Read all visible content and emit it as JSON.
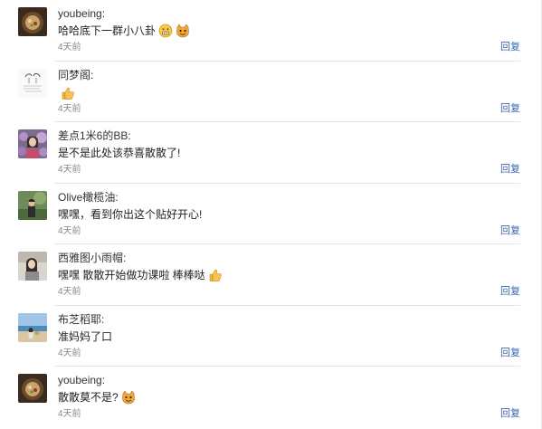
{
  "comments": [
    {
      "user": "youbeing:",
      "text": "哈哈底下一群小八卦",
      "emojis": [
        "grin-icon",
        "cat-face-icon"
      ],
      "time": "4天前",
      "reply": "回复",
      "avatar": "avatar-food-bowl"
    },
    {
      "user": "同梦阁:",
      "text": "",
      "emojis": [
        "thumbs-up-icon"
      ],
      "time": "4天前",
      "reply": "回复",
      "avatar": "avatar-sketch"
    },
    {
      "user": "差点1米6的BB:",
      "text": "是不是此处该恭喜散散了!",
      "emojis": [],
      "time": "4天前",
      "reply": "回复",
      "avatar": "avatar-flowers"
    },
    {
      "user": "Olive橄榄油:",
      "text": "嘿嘿，看到你出这个贴好开心!",
      "emojis": [],
      "time": "4天前",
      "reply": "回复",
      "avatar": "avatar-outdoor"
    },
    {
      "user": "西雅图小雨帽:",
      "text": "嘿嘿 散散开始做功课啦 棒棒哒",
      "emojis": [
        "thumbs-up-icon"
      ],
      "time": "4天前",
      "reply": "回复",
      "avatar": "avatar-portrait"
    },
    {
      "user": "布芝稻耶:",
      "text": "准妈妈了口",
      "emojis": [],
      "time": "4天前",
      "reply": "回复",
      "avatar": "avatar-beach"
    },
    {
      "user": "youbeing:",
      "text": "散散莫不是?",
      "emojis": [
        "cat-face-icon"
      ],
      "time": "4天前",
      "reply": "回复",
      "avatar": "avatar-food-bowl"
    }
  ]
}
